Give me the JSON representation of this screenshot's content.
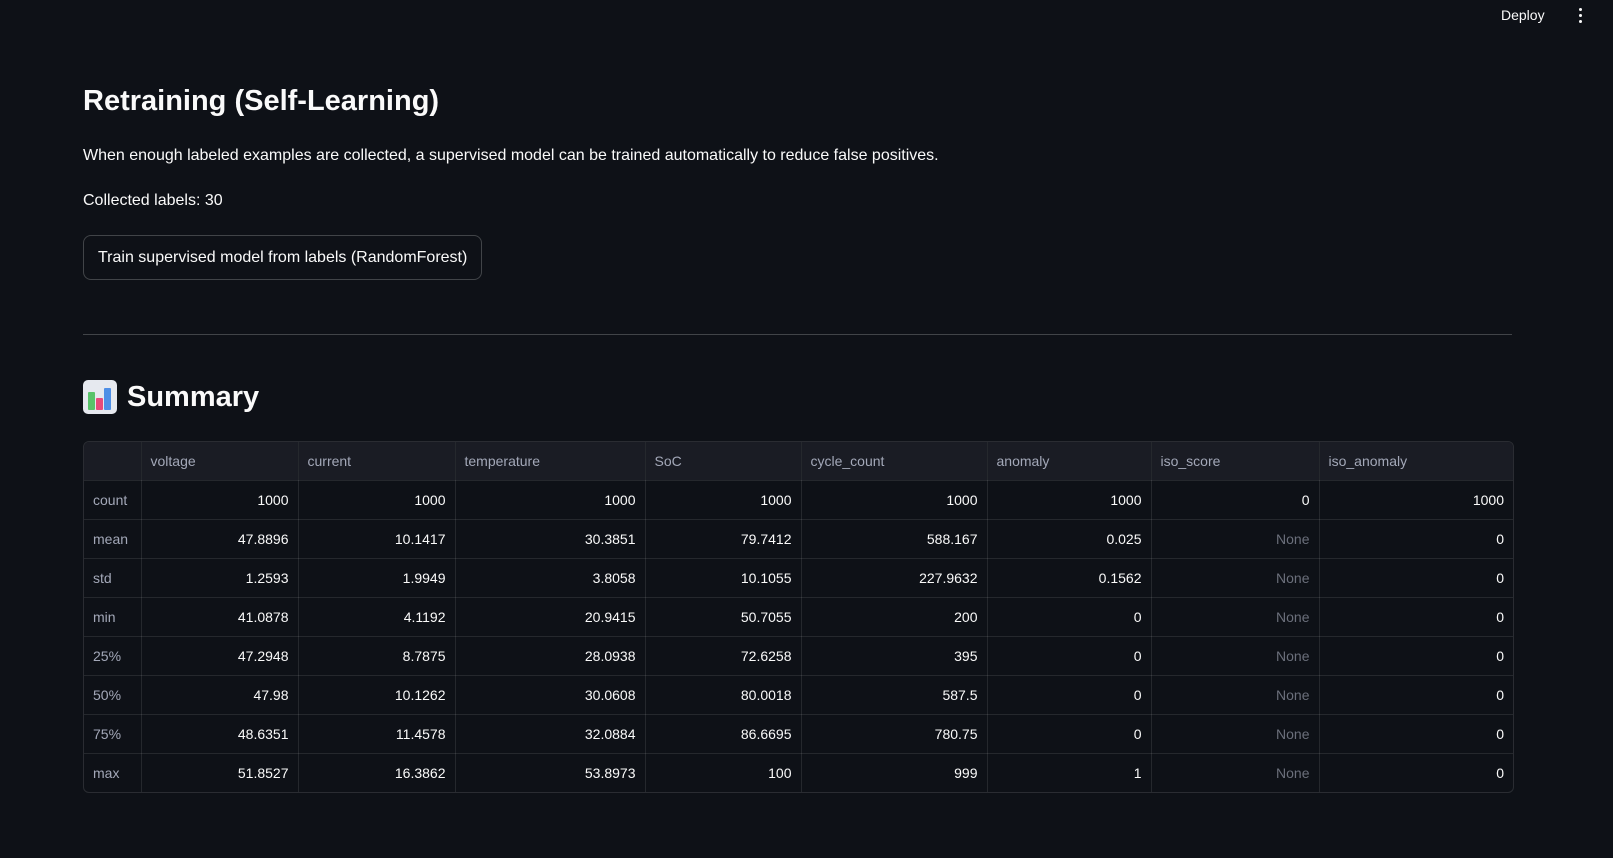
{
  "header": {
    "deploy_label": "Deploy"
  },
  "main": {
    "title": "Retraining (Self-Learning)",
    "description": "When enough labeled examples are collected, a supervised model can be trained automatically to reduce false positives.",
    "collected_labels": "Collected labels: 30",
    "train_button": "Train supervised model from labels (RandomForest)"
  },
  "summary": {
    "icon": "bar-chart-icon",
    "title": "Summary",
    "columns": [
      "",
      "voltage",
      "current",
      "temperature",
      "SoC",
      "cycle_count",
      "anomaly",
      "iso_score",
      "iso_anomaly"
    ],
    "rows": [
      [
        "count",
        "1000",
        "1000",
        "1000",
        "1000",
        "1000",
        "1000",
        "0",
        "1000"
      ],
      [
        "mean",
        "47.8896",
        "10.1417",
        "30.3851",
        "79.7412",
        "588.167",
        "0.025",
        "None",
        "0"
      ],
      [
        "std",
        "1.2593",
        "1.9949",
        "3.8058",
        "10.1055",
        "227.9632",
        "0.1562",
        "None",
        "0"
      ],
      [
        "min",
        "41.0878",
        "4.1192",
        "20.9415",
        "50.7055",
        "200",
        "0",
        "None",
        "0"
      ],
      [
        "25%",
        "47.2948",
        "8.7875",
        "28.0938",
        "72.6258",
        "395",
        "0",
        "None",
        "0"
      ],
      [
        "50%",
        "47.98",
        "10.1262",
        "30.0608",
        "80.0018",
        "587.5",
        "0",
        "None",
        "0"
      ],
      [
        "75%",
        "48.6351",
        "11.4578",
        "32.0884",
        "86.6695",
        "780.75",
        "0",
        "None",
        "0"
      ],
      [
        "max",
        "51.8527",
        "16.3862",
        "53.8973",
        "100",
        "999",
        "1",
        "None",
        "0"
      ]
    ]
  }
}
